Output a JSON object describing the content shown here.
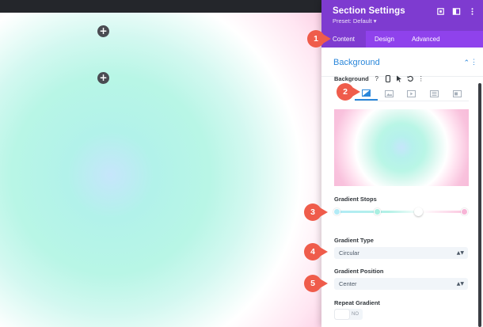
{
  "canvas": {
    "add_button_1": "+",
    "add_button_2": "+"
  },
  "panel": {
    "title": "Section Settings",
    "preset": "Preset: Default ▾",
    "tabs": [
      {
        "label": "Content",
        "active": true
      },
      {
        "label": "Design",
        "active": false
      },
      {
        "label": "Advanced",
        "active": false
      }
    ]
  },
  "background": {
    "section_title": "Background",
    "field_label": "Background",
    "type_tabs": [
      {
        "name": "gradient",
        "active": true
      },
      {
        "name": "image",
        "active": false
      },
      {
        "name": "video",
        "active": false
      },
      {
        "name": "pattern",
        "active": false
      },
      {
        "name": "mask",
        "active": false
      }
    ],
    "gradient_stops_label": "Gradient Stops",
    "gradient_stops": [
      {
        "color": "#b2ebf6",
        "position": 0
      },
      {
        "color": "#a9efe1",
        "position": 32
      },
      {
        "color": "#ffffff",
        "position": 64
      },
      {
        "color": "#f7b4d6",
        "position": 100
      }
    ],
    "gradient_type_label": "Gradient Type",
    "gradient_type_value": "Circular",
    "gradient_position_label": "Gradient Position",
    "gradient_position_value": "Center",
    "repeat_gradient_label": "Repeat Gradient",
    "repeat_gradient_value": "NO"
  },
  "callouts": [
    "1",
    "2",
    "3",
    "4",
    "5"
  ],
  "colors": {
    "header": "#7e3bd0",
    "tabs_bar": "#8f42ec",
    "accent": "#2b87da",
    "callout": "#ef5c4b"
  }
}
